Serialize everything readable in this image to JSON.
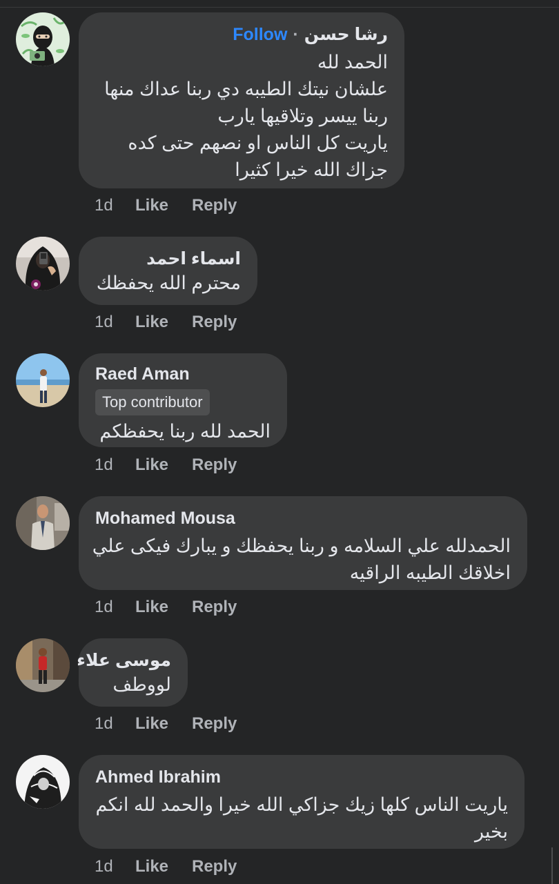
{
  "comments": [
    {
      "author": "رشا  حسن",
      "follow_label": "Follow",
      "separator": "·",
      "lines": [
        "الحمد لله",
        "علشان نيتك الطيبه دي ربنا عداك منها",
        "ربنا ييسر وتلاقيها يارب",
        "ياريت كل الناس او نصهم حتى كده",
        "جزاك الله خيرا كثيرا"
      ],
      "age": "1d",
      "like": "Like",
      "reply": "Reply"
    },
    {
      "author": "اسماء احمد",
      "lines": [
        "محترم الله يحفظك"
      ],
      "age": "1d",
      "like": "Like",
      "reply": "Reply"
    },
    {
      "author": "Raed Aman",
      "badge": "Top contributor",
      "lines": [
        "الحمد لله ربنا يحفظكم"
      ],
      "age": "1d",
      "like": "Like",
      "reply": "Reply"
    },
    {
      "author": "Mohamed Mousa",
      "lines": [
        "الحمدلله علي السلامه و ربنا يحفظك و يبارك فيكى علي",
        "اخلاقك الطيبه الراقيه"
      ],
      "age": "1d",
      "like": "Like",
      "reply": "Reply"
    },
    {
      "author": "موسى علاء",
      "lines": [
        "لووطف"
      ],
      "age": "1d",
      "like": "Like",
      "reply": "Reply"
    },
    {
      "author": "Ahmed Ibrahim",
      "lines": [
        "ياريت الناس كلها زيك جزاكي الله خيرا والحمد لله انكم",
        "بخير"
      ],
      "age": "1d",
      "like": "Like",
      "reply": "Reply"
    }
  ],
  "icons": {
    "avatar_1": "avatar-illustration-icon",
    "avatar_2": "avatar-selfie-icon",
    "avatar_3": "avatar-beach-icon",
    "avatar_4": "avatar-suit-icon",
    "avatar_5": "avatar-street-icon",
    "avatar_6": "avatar-sketch-icon"
  },
  "colors": {
    "background": "#242526",
    "bubble": "#3a3b3c",
    "text": "#e4e6eb",
    "secondary": "#b0b3b8",
    "link": "#2d88ff"
  }
}
